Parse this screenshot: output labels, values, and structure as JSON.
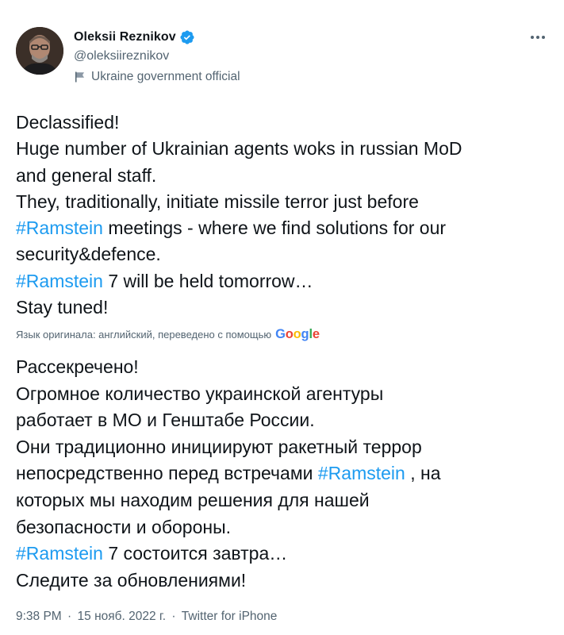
{
  "author": {
    "name": "Oleksii Reznikov",
    "handle": "@oleksiireznikov",
    "label": "Ukraine government official",
    "verified_color": "#1d9bf0"
  },
  "tweet": {
    "lines": [
      [
        {
          "text": "Declassified!"
        }
      ],
      [
        {
          "text": "Huge number of Ukrainian agents woks in russian MoD"
        }
      ],
      [
        {
          "text": "and general staff."
        }
      ],
      [
        {
          "text": "They, traditionally, initiate missile terror just before"
        }
      ],
      [
        {
          "text": "#Ramstein",
          "hashtag": true
        },
        {
          "text": " meetings - where we find solutions for our"
        }
      ],
      [
        {
          "text": "security&defence."
        }
      ],
      [
        {
          "text": "#Ramstein",
          "hashtag": true
        },
        {
          "text": " 7 will be held tomorrow…"
        }
      ],
      [
        {
          "text": "Stay tuned!"
        }
      ]
    ]
  },
  "translation_note": {
    "text": "Язык оригинала: английский, переведено с помощью",
    "provider": "Google",
    "provider_letters": [
      {
        "char": "G",
        "color": "#4285F4"
      },
      {
        "char": "o",
        "color": "#EA4335"
      },
      {
        "char": "o",
        "color": "#FBBC05"
      },
      {
        "char": "g",
        "color": "#4285F4"
      },
      {
        "char": "l",
        "color": "#34A853"
      },
      {
        "char": "e",
        "color": "#EA4335"
      }
    ]
  },
  "translated": {
    "lines": [
      [
        {
          "text": "Рассекречено!"
        }
      ],
      [
        {
          "text": "Огромное количество украинской агентуры"
        }
      ],
      [
        {
          "text": "работает в МО и Генштабе России."
        }
      ],
      [
        {
          "text": "Они традиционно инициируют ракетный террор"
        }
      ],
      [
        {
          "text": "непосредственно перед встречами "
        },
        {
          "text": "#Ramstein",
          "hashtag": true
        },
        {
          "text": " , на"
        }
      ],
      [
        {
          "text": "которых мы находим решения для нашей"
        }
      ],
      [
        {
          "text": "безопасности и обороны."
        }
      ],
      [
        {
          "text": "#Ramstein",
          "hashtag": true
        },
        {
          "text": " 7 состоится завтра…"
        }
      ],
      [
        {
          "text": "Следите за обновлениями!"
        }
      ]
    ]
  },
  "meta": {
    "time": "9:38 PM",
    "separator": "·",
    "date": "15 нояб. 2022 г.",
    "source": "Twitter for iPhone"
  },
  "colors": {
    "link": "#1d9bf0",
    "text": "#0f1419",
    "secondary": "#536471"
  },
  "icons": {
    "verified": "verified-badge-icon",
    "label": "government-flag-icon",
    "more": "more-options-icon"
  }
}
